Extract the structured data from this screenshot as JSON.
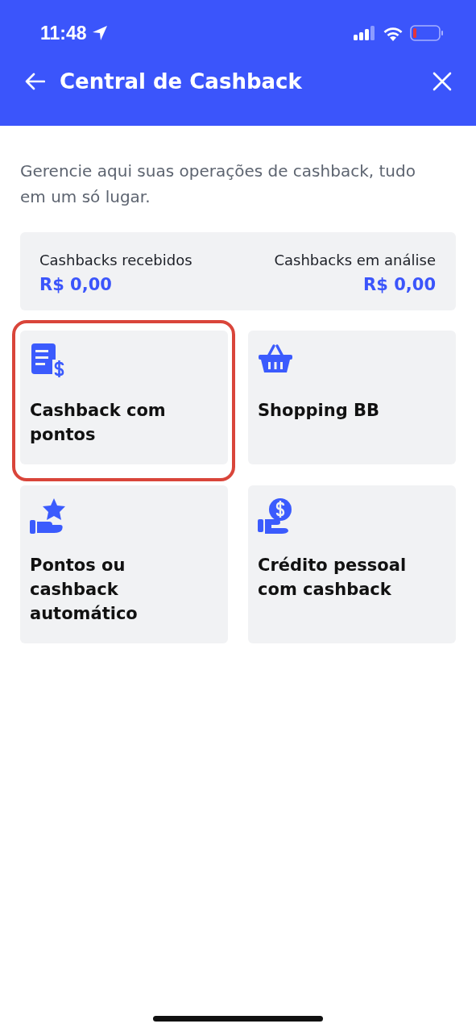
{
  "status_bar": {
    "time": "11:48"
  },
  "header": {
    "title": "Central de Cashback"
  },
  "intro": "Gerencie aqui suas operações de cashback, tudo em um só lugar.",
  "summary": [
    {
      "label": "Cashbacks recebidos",
      "value": "R$ 0,00"
    },
    {
      "label": "Cashbacks em análise",
      "value": "R$ 0,00"
    }
  ],
  "cards": [
    {
      "kind": "document",
      "label": "Cashback com pontos",
      "highlighted": true
    },
    {
      "kind": "basket",
      "label": "Shopping BB",
      "highlighted": false
    },
    {
      "kind": "starhand",
      "label": "Pontos ou cashback automático",
      "highlighted": false
    },
    {
      "kind": "coinhand",
      "label": "Crédito pessoal com cashback",
      "highlighted": false
    }
  ]
}
